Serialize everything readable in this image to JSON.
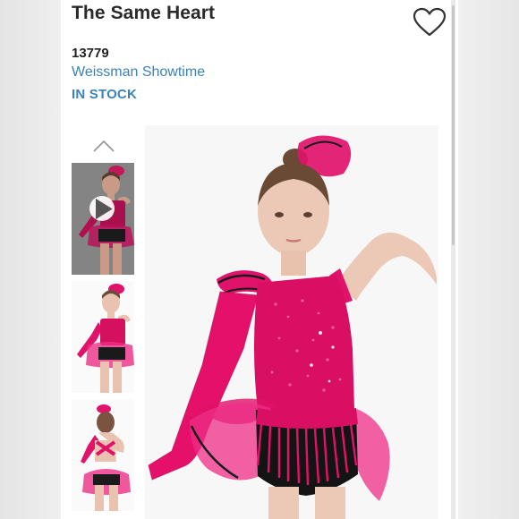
{
  "product": {
    "title": "The Same Heart",
    "sku": "13779",
    "brand": "Weissman Showtime",
    "stock_status": "IN STOCK"
  },
  "colors": {
    "link_blue": "#3b82b8",
    "costume_pink": "#e0126a",
    "title_text": "#2a2a2a"
  },
  "icons": {
    "favorite": "heart-outline-icon",
    "gallery_up": "chevron-up-icon",
    "video": "play-icon"
  },
  "gallery": {
    "thumbnails": [
      {
        "kind": "video",
        "view": "front"
      },
      {
        "kind": "image",
        "view": "front"
      },
      {
        "kind": "image",
        "view": "back"
      }
    ]
  }
}
